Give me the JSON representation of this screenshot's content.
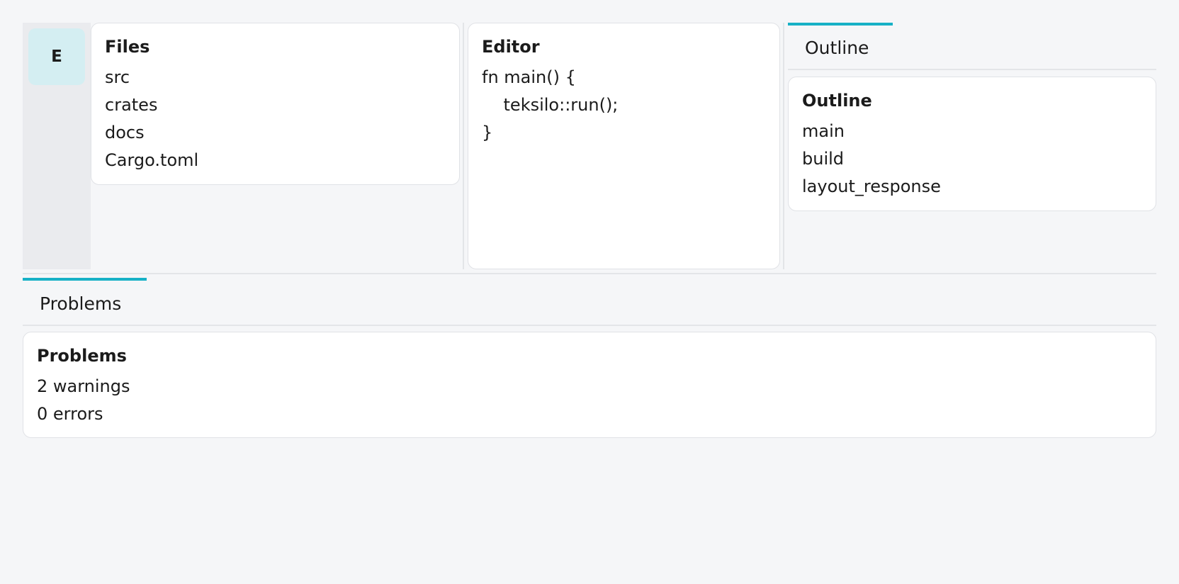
{
  "activity_bar": {
    "button_label": "E"
  },
  "files_panel": {
    "title": "Files",
    "items": [
      "src",
      "crates",
      "docs",
      "Cargo.toml"
    ]
  },
  "editor_panel": {
    "title": "Editor",
    "lines": [
      "fn main() {",
      "    teksilo::run();",
      "}"
    ]
  },
  "outline_panel": {
    "tab_label": "Outline",
    "title": "Outline",
    "items": [
      "main",
      "build",
      "layout_response"
    ]
  },
  "problems_panel": {
    "tab_label": "Problems",
    "title": "Problems",
    "items": [
      "2 warnings",
      "0 errors"
    ]
  },
  "colors": {
    "accent": "#17b1c6",
    "background": "#f5f6f8",
    "activity_bar": "#eaebee",
    "activity_button": "#d4eef2",
    "card": "#ffffff"
  }
}
